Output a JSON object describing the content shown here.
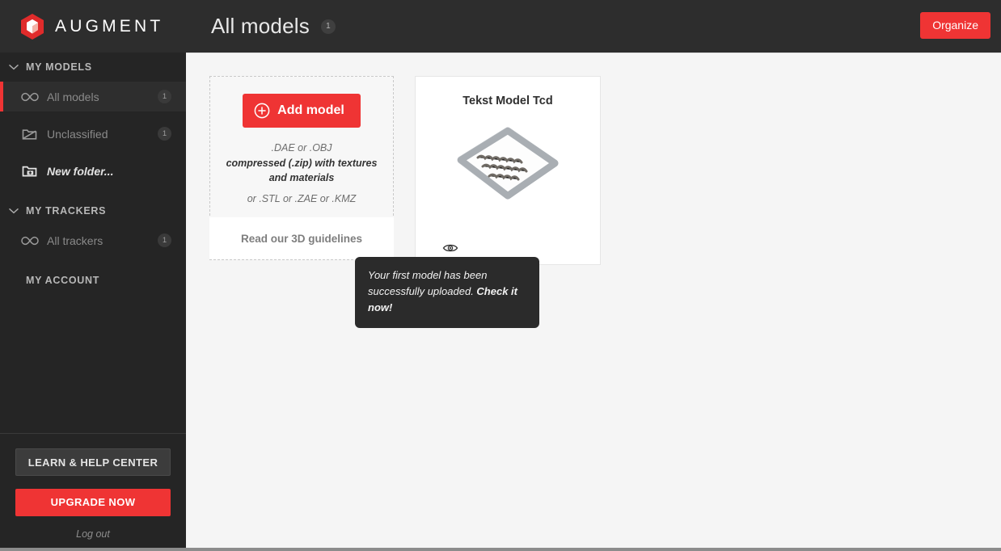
{
  "brand": {
    "name": "AUGMENT",
    "logo_icon": "augment-hexagon-cube-logo",
    "accent_color": "#ef3434"
  },
  "header": {
    "page_title": "All models",
    "page_title_count": "1",
    "organize_label": "Organize"
  },
  "sidebar": {
    "sections": [
      {
        "title": "MY MODELS",
        "chevron_icon": "chevron-down-icon",
        "items": [
          {
            "label": "All models",
            "icon": "infinity-icon",
            "count": "1",
            "active": true
          },
          {
            "label": "Unclassified",
            "icon": "folder-slash-icon",
            "count": "1",
            "active": false
          },
          {
            "label": "New folder...",
            "icon": "folder-plus-icon",
            "count": "",
            "active": false
          }
        ]
      },
      {
        "title": "MY TRACKERS",
        "chevron_icon": "chevron-down-icon",
        "items": [
          {
            "label": "All trackers",
            "icon": "infinity-icon",
            "count": "1",
            "active": false
          }
        ]
      }
    ],
    "account_section_title": "MY ACCOUNT",
    "footer": {
      "help_label": "LEARN & HELP CENTER",
      "upgrade_label": "UPGRADE NOW",
      "logout_label": "Log out"
    }
  },
  "main": {
    "add_card": {
      "add_button_label": "Add model",
      "add_button_icon": "plus-circle-icon",
      "format_line_1": ".DAE or .OBJ",
      "format_line_2": "compressed (.zip) with textures and materials",
      "format_line_3": "or .STL or .ZAE or .KMZ",
      "guidelines_label": "Read our 3D guidelines"
    },
    "models": [
      {
        "title": "Tekst Model Tcd",
        "thumbnail_icon": "3d-text-plaque-thumbnail",
        "visibility_icon": "eye-icon"
      }
    ]
  },
  "tooltip": {
    "text": "Your first model has been successfully uploaded. ",
    "cta": "Check it now!"
  }
}
